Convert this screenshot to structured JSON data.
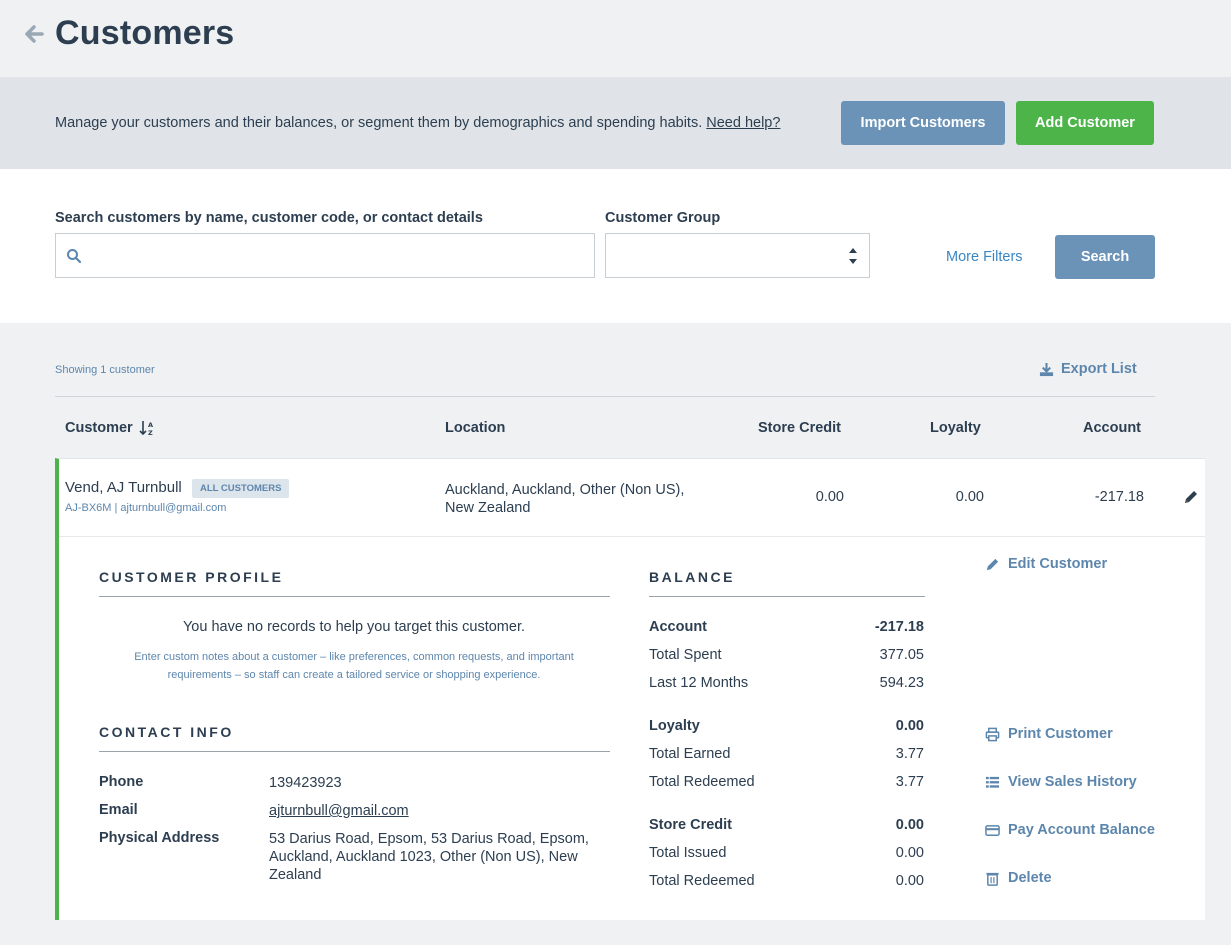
{
  "header": {
    "title": "Customers"
  },
  "intro": {
    "text": "Manage your customers and their balances, or segment them by demographics and spending habits.",
    "help_link": "Need help?",
    "import_button": "Import Customers",
    "add_button": "Add Customer"
  },
  "search": {
    "search_label": "Search customers by name, customer code, or contact details",
    "search_value": "",
    "group_label": "Customer Group",
    "group_value": "",
    "more_filters": "More Filters",
    "search_button": "Search"
  },
  "results": {
    "showing": "Showing 1 customer",
    "export": "Export List"
  },
  "table": {
    "columns": [
      "Customer",
      "Location",
      "Store Credit",
      "Loyalty",
      "Account"
    ]
  },
  "customer": {
    "name": "Vend, AJ Turnbull",
    "group_badge": "ALL CUSTOMERS",
    "sub": "AJ-BX6M | ajturnbull@gmail.com",
    "location": "Auckland, Auckland, Other (Non US), New Zealand",
    "store_credit": "0.00",
    "loyalty": "0.00",
    "account": "-217.18"
  },
  "profile": {
    "heading": "CUSTOMER PROFILE",
    "no_records": "You have no records to help you target this customer.",
    "hint": "Enter custom notes about a customer – like preferences, common requests, and important requirements – so staff can create a tailored service or shopping experience."
  },
  "contact": {
    "heading": "CONTACT INFO",
    "phone_label": "Phone",
    "phone": "139423923",
    "email_label": "Email",
    "email": "ajturnbull@gmail.com",
    "address_label": "Physical Address",
    "address": "53 Darius Road, Epsom, 53 Darius Road, Epsom, Auckland, Auckland 1023, Other (Non US), New Zealand"
  },
  "balance": {
    "heading": "BALANCE",
    "account_label": "Account",
    "account": "-217.18",
    "total_spent_label": "Total Spent",
    "total_spent": "377.05",
    "last12_label": "Last 12 Months",
    "last12": "594.23",
    "loyalty_label": "Loyalty",
    "loyalty": "0.00",
    "earned_label": "Total Earned",
    "earned": "3.77",
    "redeemed_label": "Total Redeemed",
    "redeemed": "3.77",
    "credit_label": "Store Credit",
    "credit": "0.00",
    "issued_label": "Total Issued",
    "issued": "0.00",
    "credit_redeemed_label": "Total Redeemed",
    "credit_redeemed": "0.00"
  },
  "actions": {
    "edit": "Edit Customer",
    "print": "Print Customer",
    "history": "View Sales History",
    "pay": "Pay Account Balance",
    "delete": "Delete"
  },
  "colors": {
    "accent_blue": "#6b93b8",
    "green": "#4db44a",
    "link": "#5d86ad"
  }
}
